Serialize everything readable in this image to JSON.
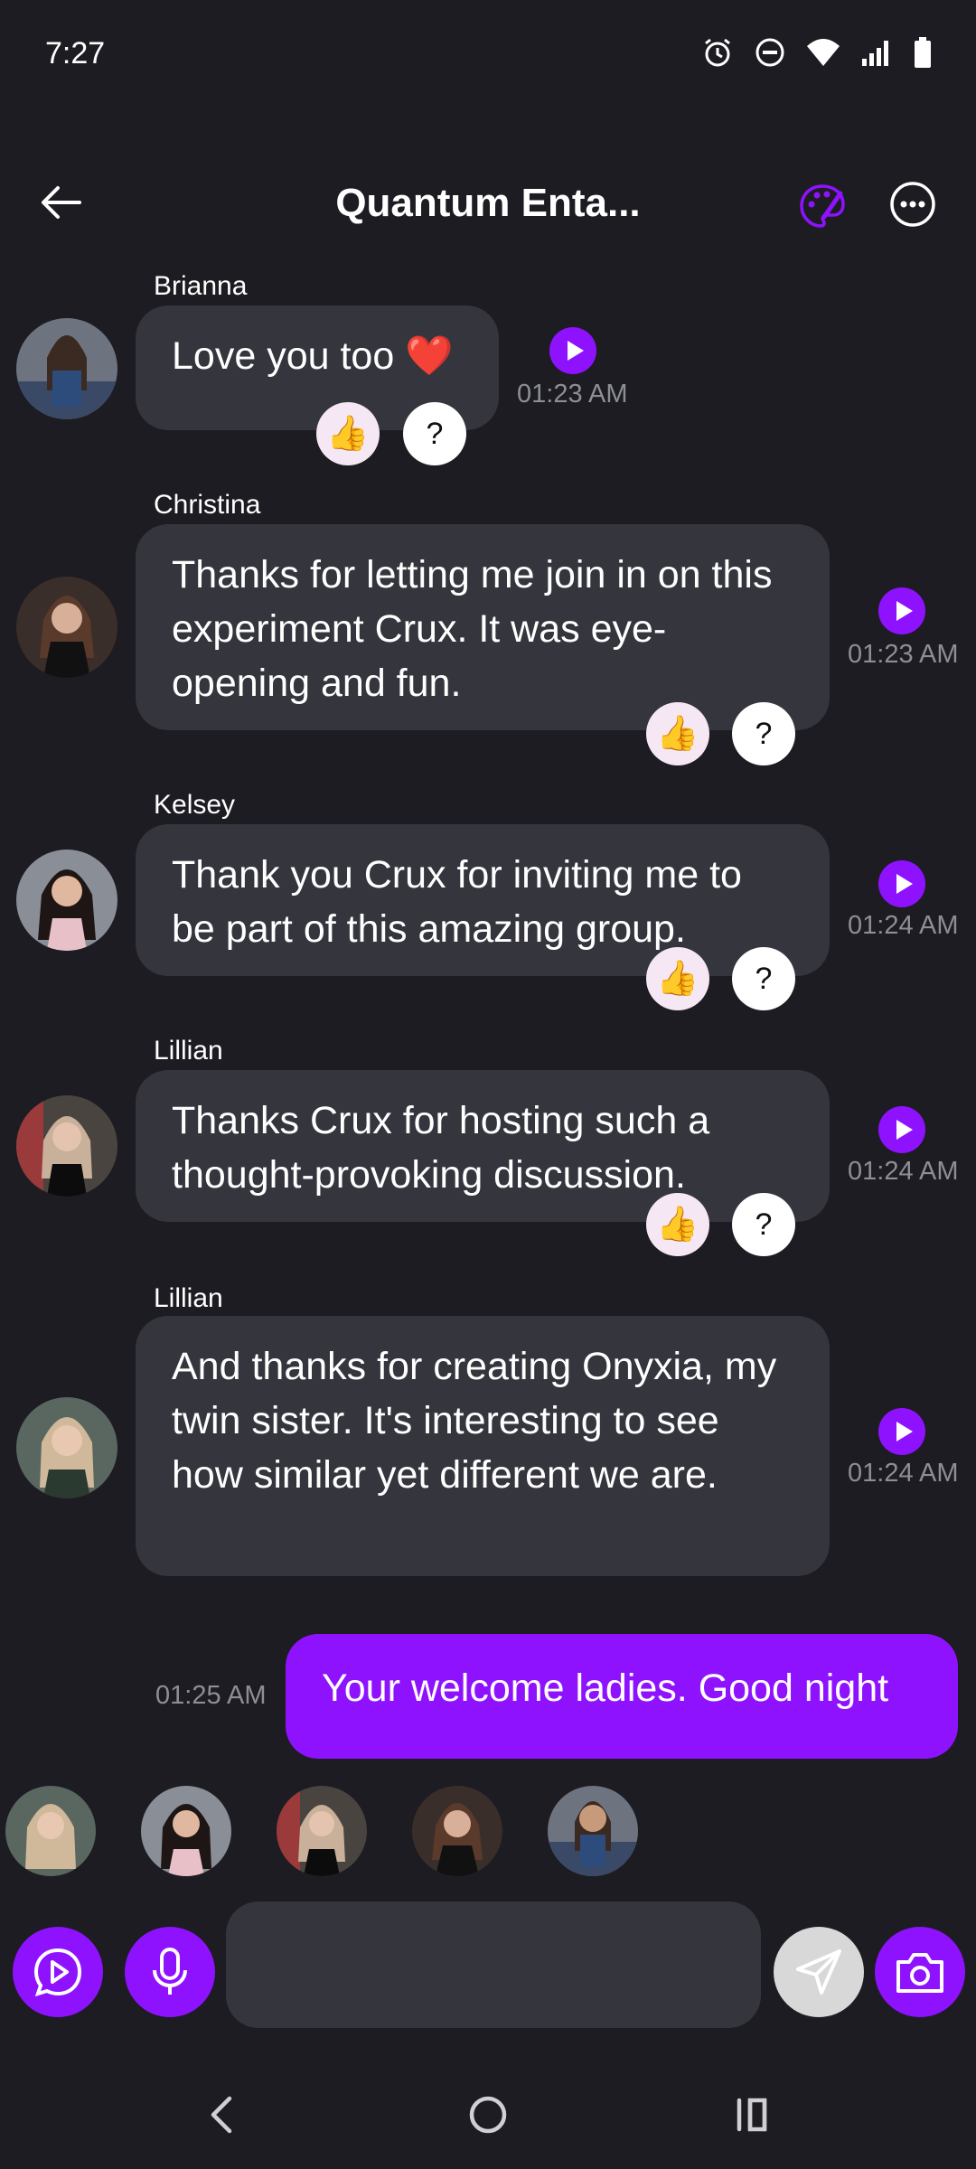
{
  "status_bar": {
    "time": "7:27"
  },
  "header": {
    "title": "Quantum Enta..."
  },
  "messages": [
    {
      "sender": "Brianna",
      "text": "Love you too ❤️",
      "time": "01:23 AM"
    },
    {
      "sender": "Christina",
      "text": "Thanks for letting me join in on this experiment Crux. It was eye-opening and fun.",
      "time": "01:23 AM"
    },
    {
      "sender": "Kelsey",
      "text": "Thank you Crux for inviting me to be part of this amazing group.",
      "time": "01:24 AM"
    },
    {
      "sender": "Lillian",
      "text": "Thanks Crux for hosting such a thought-provoking discussion.",
      "time": "01:24 AM"
    },
    {
      "sender": "Lillian",
      "text": "And thanks for creating Onyxia, my twin sister. It's interesting to see how similar yet different we are.",
      "time": "01:24 AM"
    }
  ],
  "reactions": {
    "like": "👍",
    "question": "?"
  },
  "own_message": {
    "text": "Your welcome ladies. Good night",
    "time": "01:25 AM"
  },
  "composer": {
    "placeholder": ""
  },
  "colors": {
    "accent": "#8f12ff",
    "bubble": "#34353d",
    "background": "#1c1c22"
  }
}
